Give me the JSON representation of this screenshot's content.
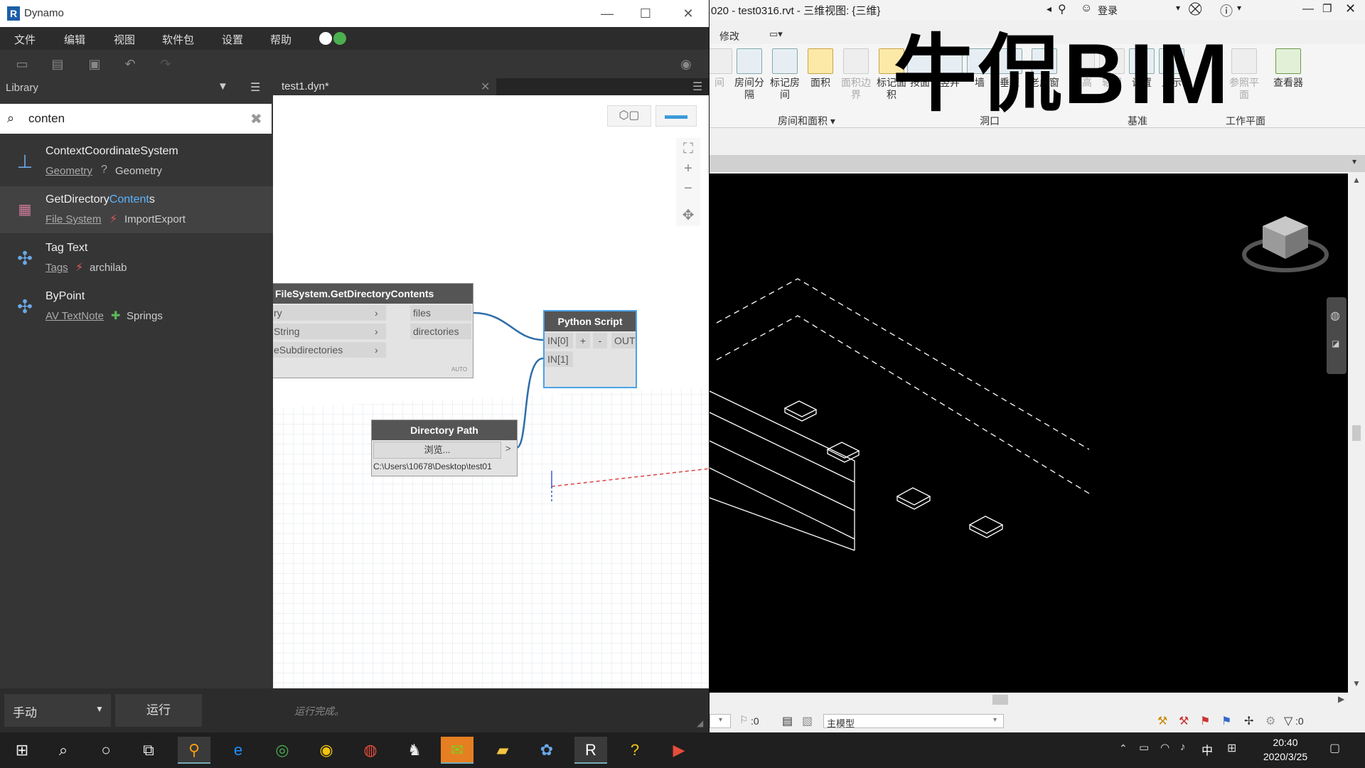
{
  "dynamo": {
    "window_title": "Dynamo",
    "menu": [
      "文件",
      "编辑",
      "视图",
      "软件包",
      "设置",
      "帮助"
    ],
    "library": {
      "title": "Library",
      "search_value": "conten",
      "items": [
        {
          "name": "ContextCoordinateSystem",
          "name_pre": "",
          "name_hl": "",
          "name_post": "",
          "category": "Geometry",
          "package": "Geometry",
          "sep": "?",
          "sep_color": "#aaaaaa"
        },
        {
          "name": "",
          "name_pre": "GetDirectory",
          "name_hl": "Content",
          "name_post": "s",
          "category": "File System",
          "package": "ImportExport",
          "sep": "⚡",
          "sep_color": "#e05a5a"
        },
        {
          "name": "Tag Text",
          "name_pre": "",
          "name_hl": "",
          "name_post": "",
          "category": "Tags",
          "package": "archilab",
          "sep": "⚡",
          "sep_color": "#e05a5a"
        },
        {
          "name": "ByPoint",
          "name_pre": "",
          "name_hl": "",
          "name_post": "",
          "category": "AV TextNote",
          "package": "Springs",
          "sep": "✚",
          "sep_color": "#5cb85c"
        }
      ]
    },
    "workspace": {
      "tab": "test1.dyn*",
      "nodes": {
        "getdir": {
          "title": "FileSystem.GetDirectoryContents",
          "inputs": [
            "ry",
            "String",
            "eSubdirectories"
          ],
          "outputs": [
            "files",
            "directories"
          ],
          "lacing": "AUTO"
        },
        "python": {
          "title": "Python Script",
          "inputs": [
            "IN[0]",
            "IN[1]"
          ],
          "add": "+",
          "remove": "-",
          "output": "OUT"
        },
        "dirpath": {
          "title": "Directory Path",
          "browse": "浏览...",
          "path": "C:\\Users\\10678\\Desktop\\test01"
        }
      }
    },
    "status": {
      "run_mode": "手动",
      "run_button": "运行",
      "message": "运行完成。"
    }
  },
  "revit": {
    "window_title": "020 - test0316.rvt - 三维视图: {三维}",
    "login": "登录",
    "tab": "修改",
    "ribbon": [
      {
        "label": "间",
        "dim": true
      },
      {
        "label": "房间分隔",
        "dim": false
      },
      {
        "label": "标记房间",
        "dim": false
      },
      {
        "label": "面积",
        "dim": false
      },
      {
        "label": "面积边界",
        "dim": true
      },
      {
        "label": "标记面积",
        "dim": false
      },
      {
        "label": "按面",
        "dim": false
      },
      {
        "label": "竖井",
        "dim": false
      },
      {
        "label": "墙",
        "dim": false
      },
      {
        "label": "垂直",
        "dim": false
      },
      {
        "label": "老虎窗",
        "dim": false
      },
      {
        "label": "标高",
        "dim": true
      },
      {
        "label": "轴网",
        "dim": true
      },
      {
        "label": "设置",
        "dim": false
      },
      {
        "label": "显示",
        "dim": false
      },
      {
        "label": "参照平面",
        "dim": true
      },
      {
        "label": "查看器",
        "dim": false
      }
    ],
    "groups": [
      "房间和面积 ▾",
      "洞口",
      "基准",
      "工作平面"
    ],
    "watermark": {
      "cn": "牛侃",
      "en": "BIM"
    },
    "status": {
      "count": ":0",
      "model": "主模型",
      "filter": ":0"
    }
  },
  "taskbar": {
    "time": "20:40",
    "date": "2020/3/25",
    "ime": "中"
  }
}
